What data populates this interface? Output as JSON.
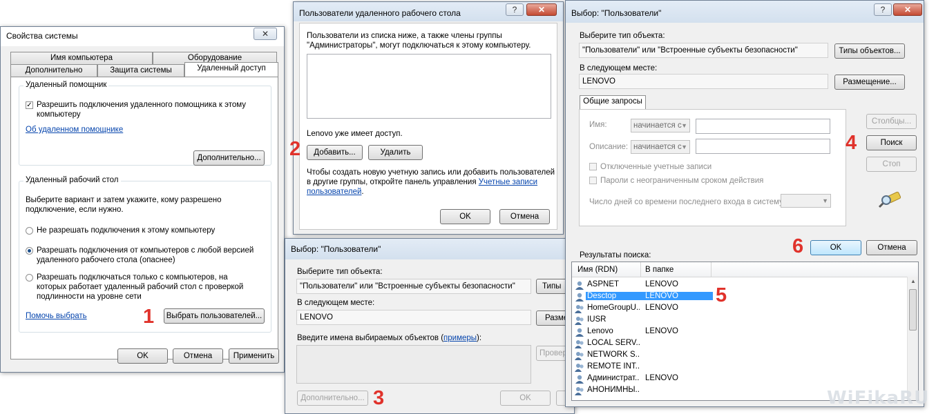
{
  "sys": {
    "title": "Свойства системы",
    "tabs_row1": [
      "Имя компьютера",
      "Оборудование"
    ],
    "tabs_row2": [
      "Дополнительно",
      "Защита системы",
      "Удаленный доступ"
    ],
    "ra_group": "Удаленный помощник",
    "ra_check": "Разрешить подключения удаленного помощника к этому компьютеру",
    "ra_link": "Об удаленном помощнике",
    "ra_more": "Дополнительно...",
    "rd_group": "Удаленный рабочий стол",
    "rd_intro": "Выберите вариант и затем укажите, кому разрешено подключение, если нужно.",
    "rd_opt1": "Не разрешать подключения к этому компьютеру",
    "rd_opt2": "Разрешать подключения от компьютеров с любой версией удаленного рабочего стола (опаснее)",
    "rd_opt3": "Разрешать подключаться только с компьютеров, на которых работает удаленный рабочий стол с проверкой подлинности на уровне сети",
    "help_link": "Помочь выбрать",
    "select_users": "Выбрать пользователей...",
    "ok": "OK",
    "cancel": "Отмена",
    "apply": "Применить"
  },
  "rdu": {
    "title": "Пользователи удаленного рабочего стола",
    "desc": "Пользователи из списка ниже, а также члены группы \"Администраторы\", могут подключаться к этому компьютеру.",
    "has_access": "Lenovo уже имеет доступ.",
    "add": "Добавить...",
    "remove": "Удалить",
    "note": "Чтобы создать новую учетную запись или добавить пользователей в другие группы, откройте панель управления ",
    "note_link": "Учетные записи пользователей",
    "note_end": ".",
    "ok": "OK",
    "cancel": "Отмена"
  },
  "sel1": {
    "title": "Выбор: \"Пользователи\"",
    "type_label": "Выберите тип объекта:",
    "type_value": "\"Пользователи\" или \"Встроенные субъекты безопасности\"",
    "types_btn": "Типы",
    "loc_label": "В следующем месте:",
    "loc_value": "LENOVO",
    "loc_btn": "Разме",
    "names_label": "Введите имена выбираемых объектов (",
    "names_link": "примеры",
    "names_end": "):",
    "check_btn": "Провер",
    "advanced": "Дополнительно...",
    "ok": "OK"
  },
  "sel2": {
    "title": "Выбор: \"Пользователи\"",
    "type_label": "Выберите тип объекта:",
    "type_value": "\"Пользователи\" или \"Встроенные субъекты безопасности\"",
    "types_btn": "Типы объектов...",
    "loc_label": "В следующем месте:",
    "loc_value": "LENOVO",
    "loc_btn": "Размещение...",
    "tab": "Общие запросы",
    "name_label": "Имя:",
    "desc_label": "Описание:",
    "starts_with": "начинается с",
    "disabled_accounts": "Отключенные учетные записи",
    "nonexp_pwd": "Пароли с неограниченным сроком действия",
    "days_label": "Число дней со времени последнего входа в систему:",
    "columns": "Столбцы...",
    "search": "Поиск",
    "stop": "Стоп",
    "ok": "OK",
    "cancel": "Отмена",
    "results_label": "Результаты поиска:",
    "col_name": "Имя (RDN)",
    "col_folder": "В папке",
    "results": [
      {
        "name": "ASPNET",
        "folder": "LENOVO"
      },
      {
        "name": "Desctop",
        "folder": "LENOVO"
      },
      {
        "name": "HomeGroupU...",
        "folder": "LENOVO"
      },
      {
        "name": "IUSR",
        "folder": ""
      },
      {
        "name": "Lenovo",
        "folder": "LENOVO"
      },
      {
        "name": "LOCAL SERV...",
        "folder": ""
      },
      {
        "name": "NETWORK S...",
        "folder": ""
      },
      {
        "name": "REMOTE INT...",
        "folder": ""
      },
      {
        "name": "Администрат...",
        "folder": "LENOVO"
      },
      {
        "name": "АНОНИМНЫ...",
        "folder": ""
      }
    ]
  },
  "steps": [
    "1",
    "2",
    "3",
    "4",
    "5",
    "6"
  ],
  "watermark": "WiFikaRU",
  "colors": {
    "step": "#e0322b",
    "selection": "#3399ff",
    "link": "#0645ad"
  }
}
